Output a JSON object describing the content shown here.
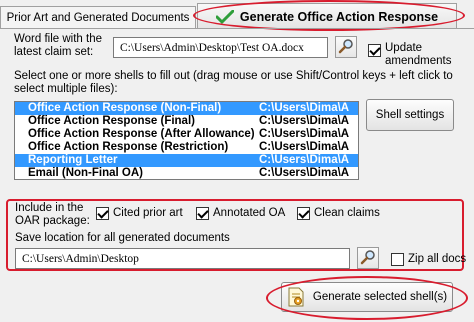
{
  "tabs": {
    "prior_label": "Prior Art and Generated Documents",
    "generate_label": "Generate Office Action Response"
  },
  "word_file": {
    "label": "Word file with the latest claim set:",
    "path": "C:\\Users\\Admin\\Desktop\\Test OA.docx"
  },
  "update_amendments": {
    "label": "Update amendments",
    "checked": true
  },
  "shells": {
    "instruction": "Select one or more shells to fill out (drag mouse or use Shift/Control keys + left click to select multiple files):",
    "items": [
      {
        "name": "Office Action Response (Non-Final)",
        "path": "C:\\Users\\Dima\\A",
        "selected": true
      },
      {
        "name": "Office Action Response (Final)",
        "path": "C:\\Users\\Dima\\A",
        "selected": false
      },
      {
        "name": "Office Action Response (After Allowance)",
        "path": "C:\\Users\\Dima\\A",
        "selected": false
      },
      {
        "name": "Office Action Response (Restriction)",
        "path": "C:\\Users\\Dima\\A",
        "selected": false
      },
      {
        "name": "Reporting Letter",
        "path": "C:\\Users\\Dima\\A",
        "selected": true
      },
      {
        "name": "Email (Non-Final OA)",
        "path": "C:\\Users\\Dima\\A",
        "selected": false
      }
    ],
    "settings_button": "Shell settings"
  },
  "package": {
    "include_label": "Include in the OAR package:",
    "cited_prior_art": {
      "label": "Cited prior art",
      "checked": true
    },
    "annotated_oa": {
      "label": "Annotated OA",
      "checked": true
    },
    "clean_claims": {
      "label": "Clean claims",
      "checked": true
    },
    "save_label": "Save location for all generated documents",
    "save_path": "C:\\Users\\Admin\\Desktop",
    "zip_all": {
      "label": "Zip all docs",
      "checked": false
    }
  },
  "generate_button": "Generate selected shell(s)",
  "colors": {
    "highlight_red": "#d81c2e",
    "selection_blue": "#3399ff",
    "check_green": "#2e9e3a"
  }
}
